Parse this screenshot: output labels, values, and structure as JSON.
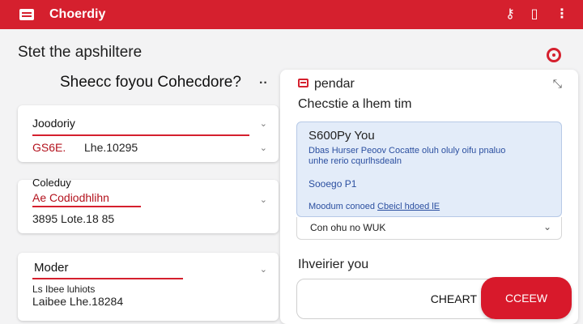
{
  "appbar": {
    "title": "Choerdiy",
    "menu_icon": "menu-icon",
    "action_icons": [
      "key-icon",
      "document-icon",
      "more-vertical-icon"
    ]
  },
  "left": {
    "heading": "Stet the apshiltere",
    "sub_heading": "Sheecc foyou Cohecdore?",
    "cards": [
      {
        "title": "Joodoriy",
        "sub": "GS6E.",
        "detail": "Lhe.10295"
      },
      {
        "title": "Coleduy",
        "sub": "Ae Codiodhlihn",
        "detail": "3895  Lote.18 85"
      },
      {
        "title": "Moder",
        "sub": "Ls Ibee luhiots",
        "detail": "Laibee  Lhe.18284"
      }
    ]
  },
  "panel": {
    "title": "pendar",
    "prompt": "Checstie a lhem tim",
    "info": {
      "title": "S600Py You",
      "line1": "Dbas Hurser Peoov Cocatte oluh oluly oifu pnaluo",
      "line2": "unhe rerio cqurlhsdealn",
      "note": "Sooego P1",
      "footer_prefix": "Moodum conoed",
      "footer_link": "Cbeicl hdoed lE"
    },
    "select_value": "Con ohu no WUK",
    "label": "Ihveirier you",
    "outline_button": "CHEART",
    "primary_button": "CCEEW"
  },
  "colors": {
    "brand": "#d5202e",
    "info_bg": "#e3ecf9",
    "info_text": "#2b4fa0"
  }
}
